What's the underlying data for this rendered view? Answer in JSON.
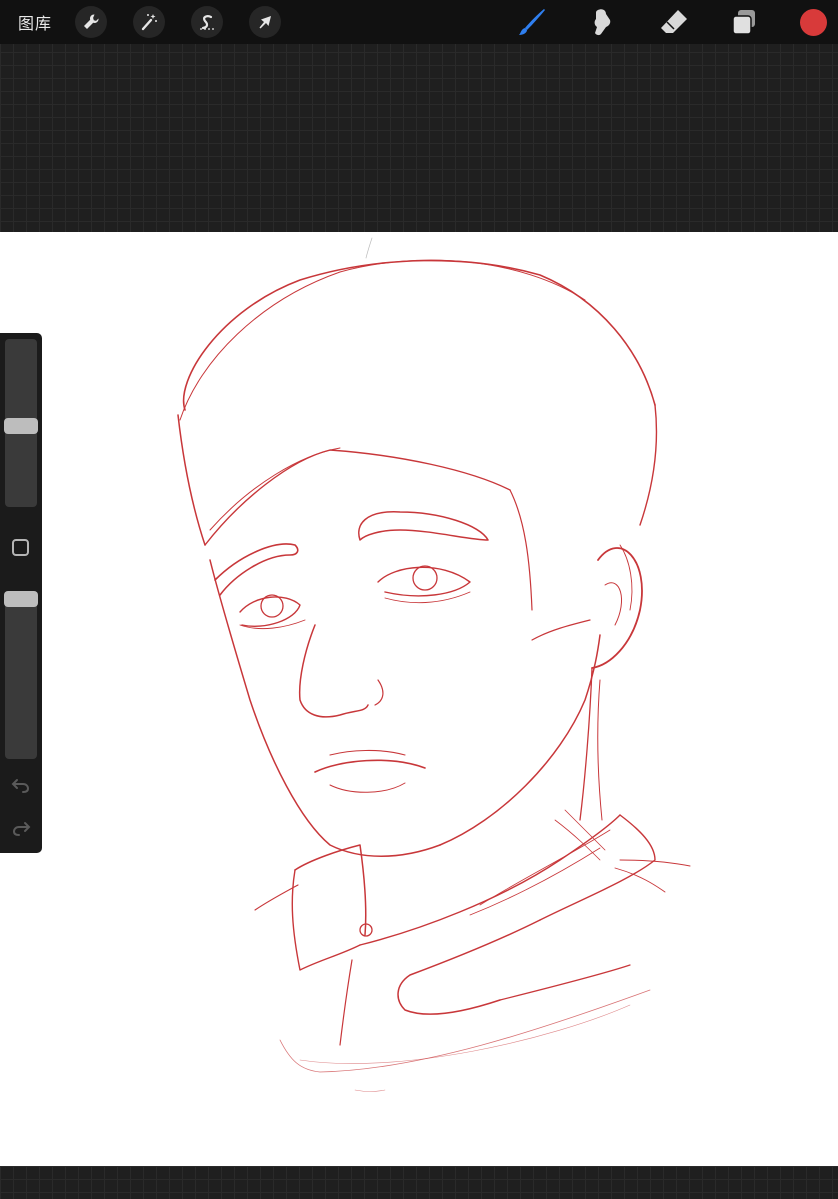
{
  "topbar": {
    "gallery_label": "图库",
    "left_tools": [
      {
        "name": "actions",
        "icon": "wrench-icon"
      },
      {
        "name": "adjustments",
        "icon": "magic-wand-icon"
      },
      {
        "name": "selection",
        "icon": "selection-s-icon"
      },
      {
        "name": "transform",
        "icon": "arrow-cursor-icon"
      }
    ],
    "right_tools": [
      {
        "name": "brush",
        "icon": "brush-icon",
        "active": true
      },
      {
        "name": "smudge",
        "icon": "smudge-icon",
        "active": false
      },
      {
        "name": "eraser",
        "icon": "eraser-icon",
        "active": false
      },
      {
        "name": "layers",
        "icon": "layers-icon",
        "active": false
      }
    ],
    "current_color": "#d83a3a"
  },
  "sidebar": {
    "brush_size_level": 0.53,
    "opacity_level": 0.05
  },
  "colors": {
    "active_tool": "#2f7ff0",
    "sketch_stroke": "#c8373a",
    "canvas": "#ffffff",
    "toolbar": "#111111"
  }
}
